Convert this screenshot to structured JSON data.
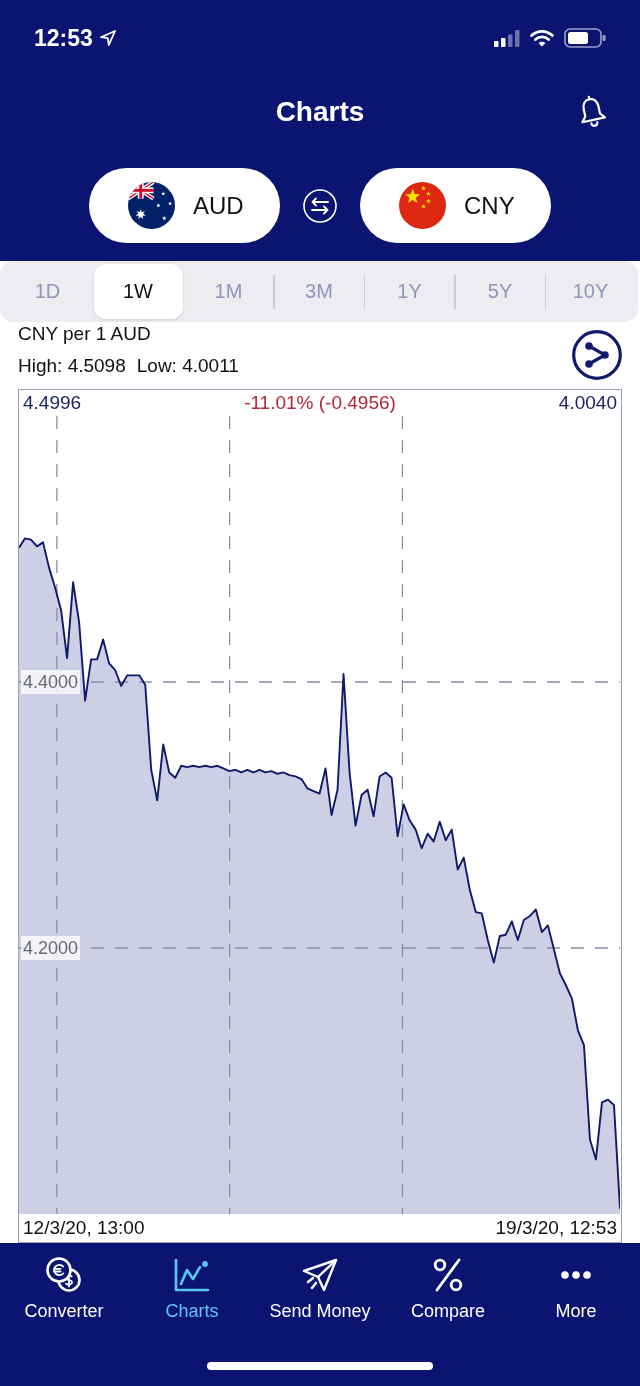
{
  "status_bar": {
    "time": "12:53"
  },
  "header": {
    "title": "Charts"
  },
  "currency_pair": [
    {
      "code": "AUD"
    },
    {
      "code": "CNY"
    }
  ],
  "period_tabs": [
    {
      "label": "1D",
      "selected": false
    },
    {
      "label": "1W",
      "selected": true
    },
    {
      "label": "1M",
      "selected": false
    },
    {
      "label": "3M",
      "selected": false
    },
    {
      "label": "1Y",
      "selected": false
    },
    {
      "label": "5Y",
      "selected": false
    },
    {
      "label": "10Y",
      "selected": false
    }
  ],
  "rate_info": {
    "caption": "CNY per 1 AUD",
    "high": "High: 4.5098",
    "low": "Low: 4.0011"
  },
  "chart": {
    "summary": [
      {
        "text": "4.4996",
        "color": "#1d2466"
      },
      {
        "text": "-11.01% (-0.4956)",
        "color": "#b3263a"
      },
      {
        "text": "4.0040",
        "color": "#1d2466"
      }
    ],
    "start_date": "12/3/20, 13:00",
    "end_date": "19/3/20, 12:53",
    "chart_data": {
      "type": "area",
      "grid": true,
      "ylim": [
        4.0,
        4.6
      ],
      "yticks": [
        {
          "value": 4.4,
          "label": "4.4000"
        },
        {
          "value": 4.2,
          "label": "4.2000"
        }
      ],
      "values": [
        4.501,
        4.508,
        4.507,
        4.502,
        4.505,
        4.486,
        4.471,
        4.454,
        4.418,
        4.475,
        4.445,
        4.386,
        4.417,
        4.417,
        4.432,
        4.414,
        4.409,
        4.397,
        4.405,
        4.405,
        4.405,
        4.398,
        4.334,
        4.311,
        4.353,
        4.332,
        4.328,
        4.337,
        4.336,
        4.337,
        4.336,
        4.337,
        4.336,
        4.337,
        4.335,
        4.333,
        4.334,
        4.332,
        4.334,
        4.332,
        4.334,
        4.332,
        4.333,
        4.331,
        4.332,
        4.33,
        4.329,
        4.327,
        4.32,
        4.318,
        4.316,
        4.335,
        4.3,
        4.319,
        4.406,
        4.332,
        4.292,
        4.315,
        4.319,
        4.299,
        4.329,
        4.332,
        4.328,
        4.284,
        4.308,
        4.296,
        4.289,
        4.275,
        4.286,
        4.28,
        4.295,
        4.281,
        4.289,
        4.259,
        4.268,
        4.244,
        4.227,
        4.226,
        4.206,
        4.189,
        4.209,
        4.21,
        4.22,
        4.206,
        4.221,
        4.224,
        4.229,
        4.212,
        4.217,
        4.199,
        4.181,
        4.172,
        4.162,
        4.138,
        4.127,
        4.056,
        4.041,
        4.084,
        4.086,
        4.082,
        4.004
      ]
    }
  },
  "tab_bar": [
    {
      "label": "Converter",
      "selected": false
    },
    {
      "label": "Charts",
      "selected": true
    },
    {
      "label": "Send Money",
      "selected": false
    },
    {
      "label": "Compare",
      "selected": false
    },
    {
      "label": "More",
      "selected": false
    }
  ]
}
